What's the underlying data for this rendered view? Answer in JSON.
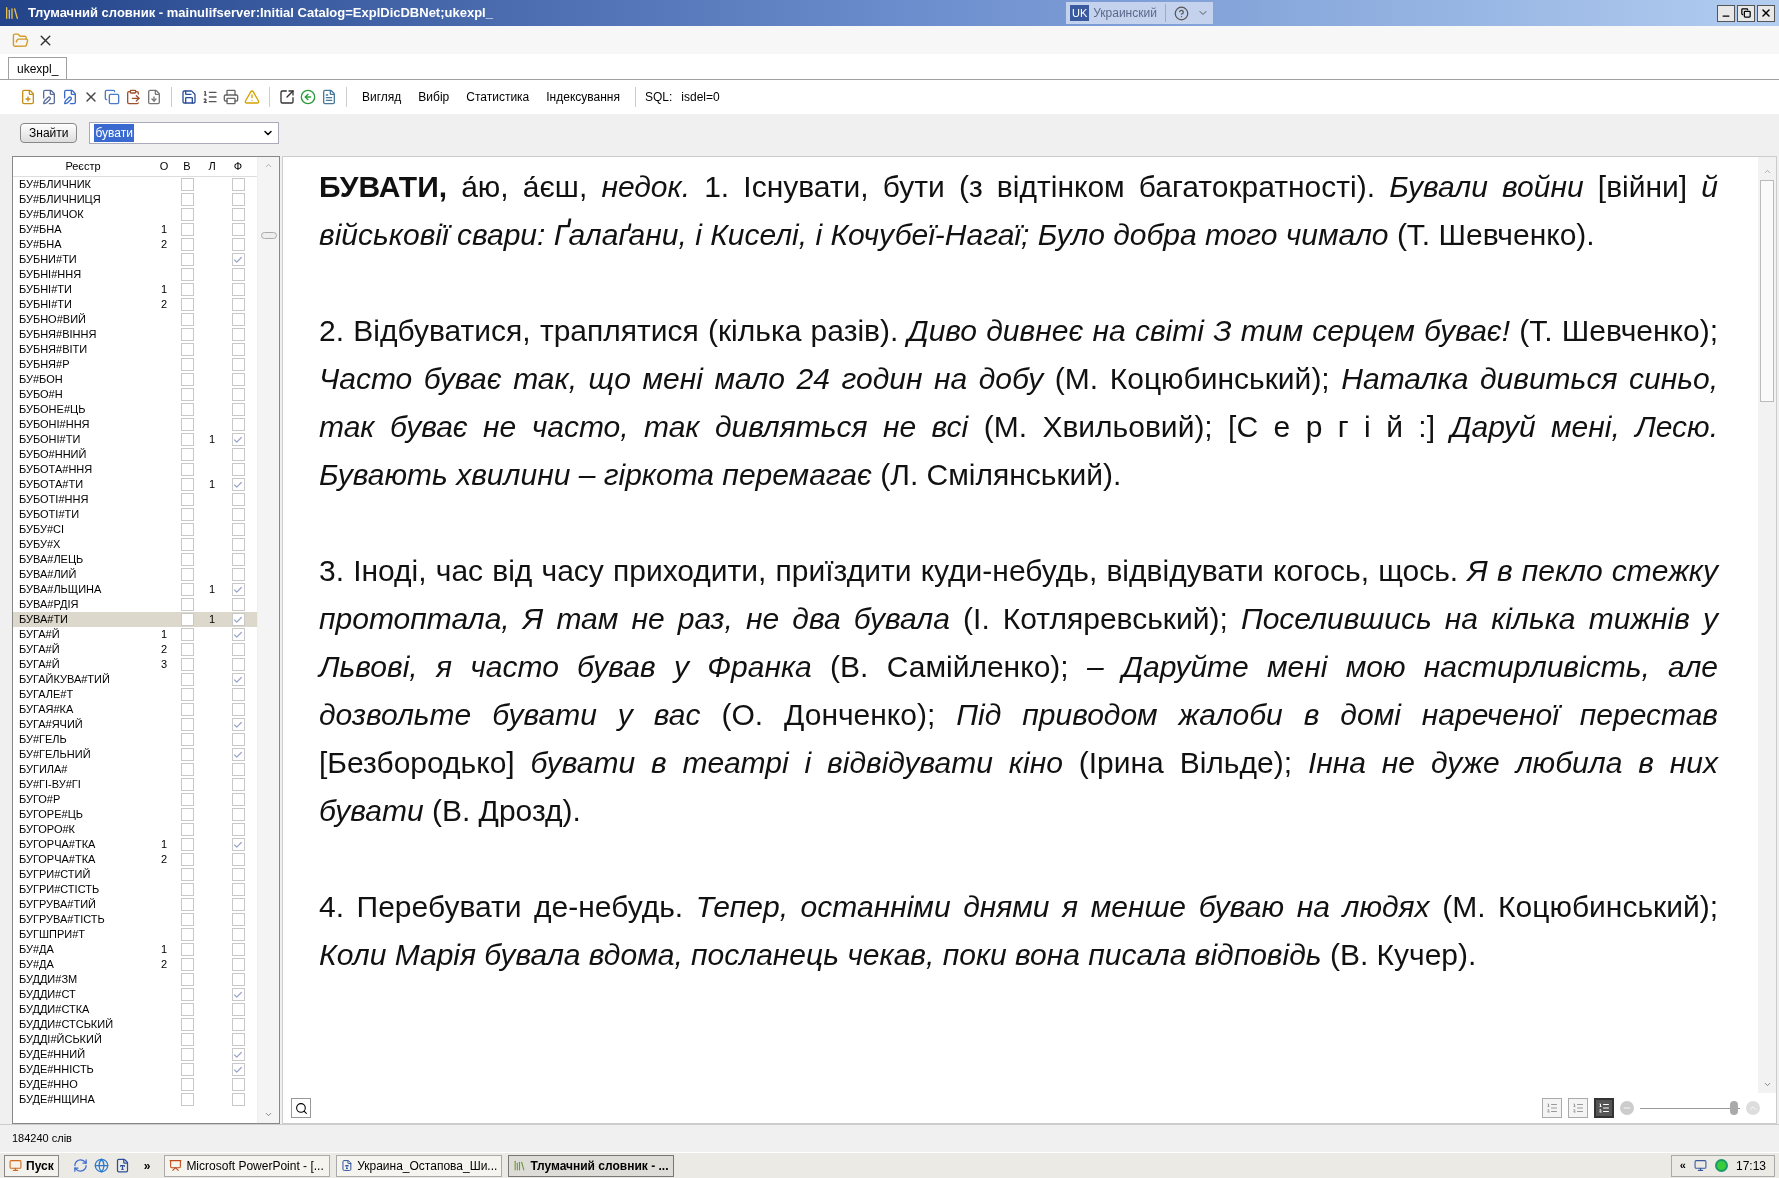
{
  "window": {
    "title": "Тлумачний словник - mainulifserver:Initial Catalog=ExplDicDBNet;ukexpl_"
  },
  "language_bar": {
    "code": "UK",
    "language": "Украинский"
  },
  "document_tabs": [
    {
      "label": "ukexpl_",
      "selected": true
    }
  ],
  "toolbar": {
    "menus": [
      "Вигляд",
      "Вибір",
      "Статистика",
      "Індексування"
    ],
    "sql_label": "SQL:",
    "sql_value": "isdel=0"
  },
  "search": {
    "button": "Знайти",
    "value": "бувати"
  },
  "word_list": {
    "columns": [
      "Реєстр",
      "О",
      "В",
      "Л",
      "Ф"
    ],
    "rows": [
      {
        "word": "БУ#БЛИЧНИК",
        "v": false,
        "f": false,
        "selected": false
      },
      {
        "word": "БУ#БЛИЧНИЦЯ",
        "v": false,
        "f": false,
        "selected": false
      },
      {
        "word": "БУ#БЛИЧОК",
        "v": false,
        "f": false,
        "selected": false
      },
      {
        "word": "БУ#БНА",
        "o": "1",
        "v": false,
        "f": false,
        "selected": false
      },
      {
        "word": "БУ#БНА",
        "o": "2",
        "v": false,
        "f": false,
        "selected": false
      },
      {
        "word": "БУБНИ#ТИ",
        "v": false,
        "f": true,
        "selected": false
      },
      {
        "word": "БУБНІ#ННЯ",
        "v": false,
        "f": false,
        "selected": false
      },
      {
        "word": "БУБНІ#ТИ",
        "o": "1",
        "v": false,
        "f": false,
        "selected": false
      },
      {
        "word": "БУБНІ#ТИ",
        "o": "2",
        "v": false,
        "f": false,
        "selected": false
      },
      {
        "word": "БУБНО#ВИЙ",
        "v": false,
        "f": false,
        "selected": false
      },
      {
        "word": "БУБНЯ#ВІННЯ",
        "v": false,
        "f": false,
        "selected": false
      },
      {
        "word": "БУБНЯ#ВІТИ",
        "v": false,
        "f": false,
        "selected": false
      },
      {
        "word": "БУБНЯ#Р",
        "v": false,
        "f": false,
        "selected": false
      },
      {
        "word": "БУ#БОН",
        "v": false,
        "f": false,
        "selected": false
      },
      {
        "word": "БУБО#Н",
        "v": false,
        "f": false,
        "selected": false
      },
      {
        "word": "БУБОНЕ#ЦЬ",
        "v": false,
        "f": false,
        "selected": false
      },
      {
        "word": "БУБОНІ#ННЯ",
        "v": false,
        "f": false,
        "selected": false
      },
      {
        "word": "БУБОНІ#ТИ",
        "l": "1",
        "v": false,
        "f": true,
        "selected": false
      },
      {
        "word": "БУБО#ННИЙ",
        "v": false,
        "f": false,
        "selected": false
      },
      {
        "word": "БУБОТА#ННЯ",
        "v": false,
        "f": false,
        "selected": false
      },
      {
        "word": "БУБОТА#ТИ",
        "l": "1",
        "v": false,
        "f": true,
        "selected": false
      },
      {
        "word": "БУБОТІ#ННЯ",
        "v": false,
        "f": false,
        "selected": false
      },
      {
        "word": "БУБОТІ#ТИ",
        "v": false,
        "f": false,
        "selected": false
      },
      {
        "word": "БУБУ#СІ",
        "v": false,
        "f": false,
        "selected": false
      },
      {
        "word": "БУБУ#Х",
        "v": false,
        "f": false,
        "selected": false
      },
      {
        "word": "БУВА#ЛЕЦЬ",
        "v": false,
        "f": false,
        "selected": false
      },
      {
        "word": "БУВА#ЛИЙ",
        "v": false,
        "f": false,
        "selected": false
      },
      {
        "word": "БУВА#ЛЬЩИНА",
        "l": "1",
        "v": false,
        "f": true,
        "selected": false
      },
      {
        "word": "БУВА#РДІЯ",
        "v": false,
        "f": false,
        "selected": false
      },
      {
        "word": "БУВА#ТИ",
        "l": "1",
        "v": false,
        "f": true,
        "selected": true
      },
      {
        "word": "БУГА#Й",
        "o": "1",
        "v": false,
        "f": true,
        "selected": false
      },
      {
        "word": "БУГА#Й",
        "o": "2",
        "v": false,
        "f": false,
        "selected": false
      },
      {
        "word": "БУГА#Й",
        "o": "3",
        "v": false,
        "f": false,
        "selected": false
      },
      {
        "word": "БУГАЙКУВА#ТИЙ",
        "v": false,
        "f": true,
        "selected": false
      },
      {
        "word": "БУГАЛЕ#Т",
        "v": false,
        "f": false,
        "selected": false
      },
      {
        "word": "БУГАЯ#КА",
        "v": false,
        "f": false,
        "selected": false
      },
      {
        "word": "БУГА#ЯЧИЙ",
        "v": false,
        "f": true,
        "selected": false
      },
      {
        "word": "БУ#ГЕЛЬ",
        "v": false,
        "f": false,
        "selected": false
      },
      {
        "word": "БУ#ГЕЛЬНИЙ",
        "v": false,
        "f": true,
        "selected": false
      },
      {
        "word": "БУГИЛА#",
        "v": false,
        "f": false,
        "selected": false
      },
      {
        "word": "БУ#ГІ-ВУ#ГІ",
        "v": false,
        "f": false,
        "selected": false
      },
      {
        "word": "БУГО#Р",
        "v": false,
        "f": false,
        "selected": false
      },
      {
        "word": "БУГОРЕ#ЦЬ",
        "v": false,
        "f": false,
        "selected": false
      },
      {
        "word": "БУГОРО#К",
        "v": false,
        "f": false,
        "selected": false
      },
      {
        "word": "БУГОРЧА#ТКА",
        "o": "1",
        "v": false,
        "f": true,
        "selected": false
      },
      {
        "word": "БУГОРЧА#ТКА",
        "o": "2",
        "v": false,
        "f": false,
        "selected": false
      },
      {
        "word": "БУГРИ#СТИЙ",
        "v": false,
        "f": false,
        "selected": false
      },
      {
        "word": "БУГРИ#СТІСТЬ",
        "v": false,
        "f": false,
        "selected": false
      },
      {
        "word": "БУГРУВА#ТИЙ",
        "v": false,
        "f": false,
        "selected": false
      },
      {
        "word": "БУГРУВА#ТІСТЬ",
        "v": false,
        "f": false,
        "selected": false
      },
      {
        "word": "БУГШПРИ#Т",
        "v": false,
        "f": false,
        "selected": false
      },
      {
        "word": "БУ#ДА",
        "o": "1",
        "v": false,
        "f": false,
        "selected": false
      },
      {
        "word": "БУ#ДА",
        "o": "2",
        "v": false,
        "f": false,
        "selected": false
      },
      {
        "word": "БУДДИ#ЗМ",
        "v": false,
        "f": false,
        "selected": false
      },
      {
        "word": "БУДДИ#СТ",
        "v": false,
        "f": true,
        "selected": false
      },
      {
        "word": "БУДДИ#СТКА",
        "v": false,
        "f": false,
        "selected": false
      },
      {
        "word": "БУДДИ#СТСЬКИЙ",
        "v": false,
        "f": false,
        "selected": false
      },
      {
        "word": "БУДДІ#ЙСЬКИЙ",
        "v": false,
        "f": false,
        "selected": false
      },
      {
        "word": "БУДЕ#ННИЙ",
        "v": false,
        "f": true,
        "selected": false
      },
      {
        "word": "БУДЕ#ННІСТЬ",
        "v": false,
        "f": true,
        "selected": false
      },
      {
        "word": "БУДЕ#ННО",
        "v": false,
        "f": false,
        "selected": false
      },
      {
        "word": "БУДЕ#НЩИНА",
        "v": false,
        "f": false,
        "selected": false
      }
    ]
  },
  "article": {
    "paragraphs": [
      "**БУВАТИ,** а́ю, а́єш, *недок.* 1. Існувати, бути (з відтінком багатократності). *Бували войни* [війни] *й військовії свари: Ґалаґани, і Киселі, і Кочубеї-Нагаї; Було добра того чимало* (Т. Шевченко).",
      "2. Відбуватися, траплятися (кілька разів). *Диво дивнеє на світі З тим серцем буває!* (Т. Шевченко); *Часто буває так, що мені мало 24 годин на добу* (М. Коцюбинський); *Наталка дивиться синьо, так буває не часто, так дивляться не всі* (М. Хвильовий); [С е р г і й :] *Даруй мені, Лесю. Бувають хвилини – гіркота перемагає* (Л. Смілянський).",
      "3. Іноді, час від часу приходити, приїздити куди-небудь, відвідувати когось, щось. *Я в пекло стежку протоптала, Я там не раз, не два бувала* (І. Котляревський); *Поселившись на кілька тижнів у Львові, я часто бував у Франка* (В. Самійленко); *– Даруйте мені мою настирливість, але дозвольте бувати у вас* (О. Донченко); *Під приводом жалоби в домі нареченої перестав* [Безбородько] *бувати в театрі і відвідувати кіно* (Ірина Вільде); *Інна не дуже любила в них бувати* (В. Дрозд).",
      "4. Перебувати де-небудь. *Тепер, останніми днями я менше буваю на людях* (М. Коцюбинський); *Коли Марія бувала вдома, посланець чекав, поки вона писала відповідь* (В. Кучер)."
    ]
  },
  "view_modes": [
    {
      "selected": false
    },
    {
      "selected": false
    },
    {
      "selected": true
    }
  ],
  "zoom": {
    "level": 0.94
  },
  "status_bar": "184240 слів",
  "taskbar": {
    "start": "Пуск",
    "overflow": "»",
    "buttons": [
      {
        "label": "Microsoft PowerPoint - [...",
        "selected": false
      },
      {
        "label": "Украина_Остапова_Ши...",
        "selected": false
      },
      {
        "label": "Тлумачний словник - ...",
        "selected": true
      }
    ],
    "tray_expand": "«",
    "clock": "17:13"
  }
}
